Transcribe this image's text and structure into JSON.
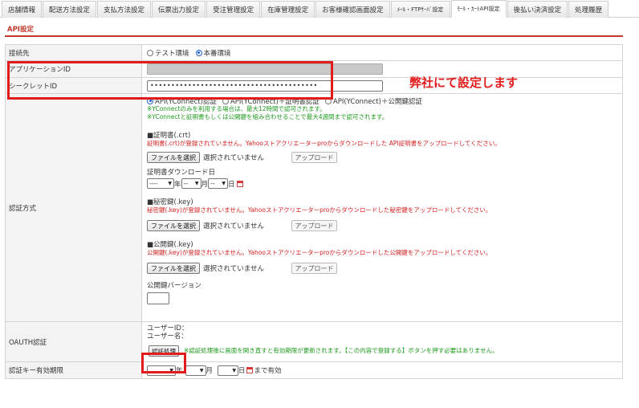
{
  "tabs": [
    {
      "label": "店舗情報",
      "active": false,
      "small": false
    },
    {
      "label": "配送方法設定",
      "active": false,
      "small": false
    },
    {
      "label": "支払方法設定",
      "active": false,
      "small": false
    },
    {
      "label": "伝票出力設定",
      "active": false,
      "small": false
    },
    {
      "label": "受注管理設定",
      "active": false,
      "small": false
    },
    {
      "label": "在庫管理設定",
      "active": false,
      "small": false
    },
    {
      "label": "お客様確認画面設定",
      "active": false,
      "small": false
    },
    {
      "label": "ﾒｰﾙ・FTPｻｰﾊﾞ設定",
      "active": false,
      "small": true
    },
    {
      "label": "ﾓｰﾙ・ｶｰﾄAPI設定",
      "active": true,
      "small": true
    },
    {
      "label": "後払い決済設定",
      "active": false,
      "small": false
    },
    {
      "label": "処理履歴",
      "active": false,
      "small": false
    }
  ],
  "section_title": "API設定",
  "rows": {
    "connection": {
      "label": "接続先",
      "options": [
        "テスト環境",
        "本番環境"
      ]
    },
    "app_id": {
      "label": "アプリケーションID"
    },
    "secret_id": {
      "label": "シークレットID",
      "value": "••••••••••••••••••••••••••••••••••••••••"
    },
    "auth": {
      "label": "認証方式",
      "options": [
        "API(YConnect)認証",
        "API(YConnect)＋証明書認証",
        "API(YConnect)＋公開鍵認証"
      ],
      "note1": "※YConnectのみを利用する場合は、最大12時間で認可されます。",
      "note2": "※YConnectと証明書もしくは公開鍵を組み合わせることで最大4週間まで認可されます。",
      "cert_title": "■証明書(.crt)",
      "cert_warn": "証明書(.crt)が登録されていません。Yahooストアクリエーターproからダウンロードした API証明書をアップロードしてください。",
      "choose_file": "ファイルを選択",
      "no_file": "選択されていません",
      "upload": "アップロード",
      "cert_date_label": "証明書ダウンロード日",
      "year_placeholder": "----",
      "md_placeholder": "--",
      "year_unit": "年",
      "month_unit": "月",
      "day_unit": "日",
      "secret_key_title": "■秘密鍵(.key)",
      "secret_key_warn": "秘密鍵(.key)が登録されていません。Yahooストアクリエーターproからダウンロードした秘密鍵をアップロードしてください。",
      "public_key_title": "■公開鍵(.key)",
      "public_key_warn": "公開鍵(.key)が登録されていません。Yahooストアクリエーターproからダウンロードした公開鍵をアップロードしてください。",
      "public_key_version": "公開鍵バージョン"
    },
    "oauth": {
      "label": "OAUTH認証",
      "user_id": "ユーザーID：",
      "user_name": "ユーザー名：",
      "button": "認証処理",
      "note": "※認証処理後に画面を開き直すと有効期限が更新されます。【この内容で登録する】ボタンを押す必要はありません。"
    },
    "expiry": {
      "label": "認証キー有効期限",
      "year_unit": "年",
      "month_unit": "月",
      "day_unit": "日",
      "until": "まで有効"
    }
  },
  "annotation": "弊社にて設定します",
  "colors": {
    "accent": "#c0392b",
    "annotation": "#e21c1c",
    "note_green": "#1e9b1e",
    "warn_red": "#d41e1e",
    "radio": "#1a5fd1"
  }
}
